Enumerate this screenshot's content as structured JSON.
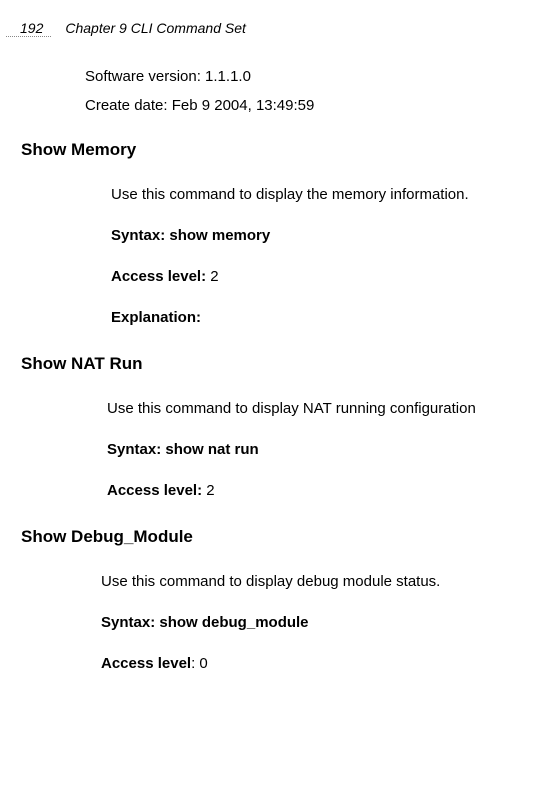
{
  "header": {
    "pageNumber": "192",
    "chapterTitle": "Chapter 9 CLI Command Set"
  },
  "intro": {
    "softwareVersion": "Software version: 1.1.1.0",
    "createDate": "Create date: Feb 9 2004, 13:49:59"
  },
  "sections": [
    {
      "heading": "Show Memory",
      "description": "Use this command to display the memory information.",
      "syntax": "Syntax: show memory",
      "accessLabel": "Access level: ",
      "accessValue": "2",
      "explanationLabel": "Explanation:"
    },
    {
      "heading": "Show NAT Run",
      "description": "Use this command to display NAT running configuration",
      "syntax": "Syntax: show nat run",
      "accessLabel": "Access level: ",
      "accessValue": "2"
    },
    {
      "heading": "Show Debug_Module",
      "description": "Use this command to display debug module status.",
      "syntax": "Syntax: show debug_module",
      "accessLabel": "Access level",
      "accessValue": ": 0"
    }
  ]
}
